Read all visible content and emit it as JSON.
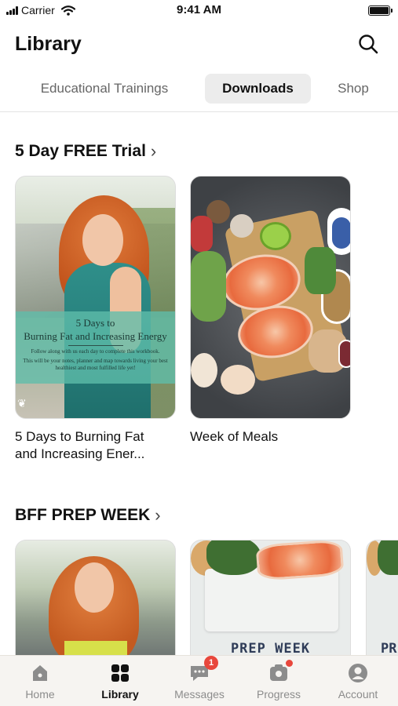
{
  "status_bar": {
    "carrier": "Carrier",
    "time": "9:41 AM",
    "wifi_icon": "wifi-icon",
    "battery_icon": "battery-icon"
  },
  "header": {
    "title": "Library",
    "search_icon": "search-icon"
  },
  "tabs": [
    {
      "label": "Educational Trainings",
      "active": false
    },
    {
      "label": "Downloads",
      "active": true
    },
    {
      "label": "Shop",
      "active": false
    }
  ],
  "sections": [
    {
      "title": "5 Day FREE Trial",
      "chevron_icon": "chevron-right-icon",
      "items": [
        {
          "label_line1": "5 Days to Burning Fat",
          "label_line2": "and Increasing Ener...",
          "cover_title_line1": "5 Days to",
          "cover_title_line2": "Burning Fat and Increasing Energy",
          "cover_text_line1": "Follow along with us each day to complete this workbook.",
          "cover_text_line2": "This will be your notes, planner and map towards living your best",
          "cover_text_line3": "healthiest and most fulfilled life yet!"
        },
        {
          "label": "Week of Meals"
        }
      ]
    },
    {
      "title": "BFF PREP WEEK",
      "chevron_icon": "chevron-right-icon",
      "items": [
        {
          "cover_text": ""
        },
        {
          "cover_text": "PREP WEEK"
        },
        {
          "cover_text": "PR"
        }
      ]
    }
  ],
  "tab_bar": [
    {
      "label": "Home",
      "icon": "home-icon",
      "active": false
    },
    {
      "label": "Library",
      "icon": "library-grid-icon",
      "active": true
    },
    {
      "label": "Messages",
      "icon": "messages-icon",
      "active": false,
      "badge": "1"
    },
    {
      "label": "Progress",
      "icon": "camera-icon",
      "active": false,
      "dot": true
    },
    {
      "label": "Account",
      "icon": "account-icon",
      "active": false
    }
  ],
  "colors": {
    "accent_badge": "#e8473c",
    "tab_active_bg": "#ececec",
    "tabbar_bg": "#f6f4f1"
  }
}
